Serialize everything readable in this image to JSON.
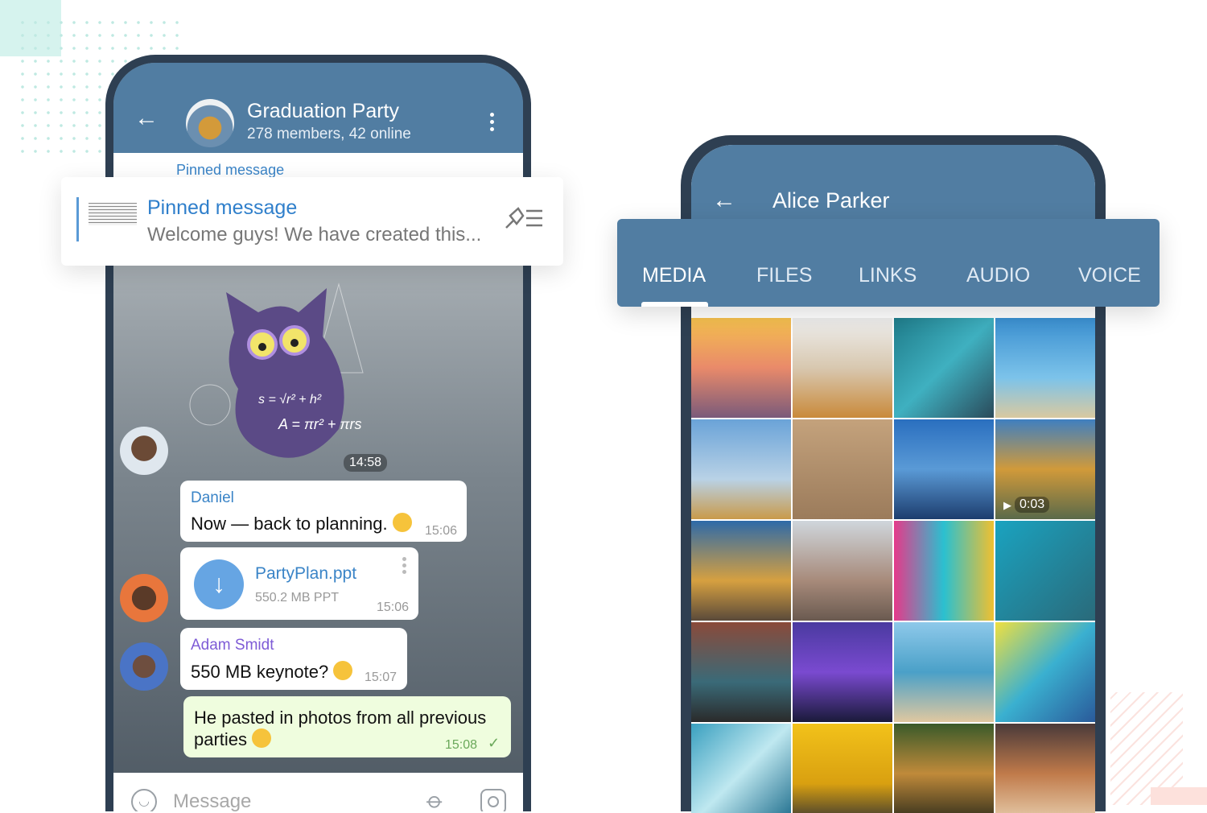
{
  "chat": {
    "title": "Graduation Party",
    "subtitle": "278 members, 42 online",
    "pinned": {
      "label": "Pinned message",
      "text": "Welcome guys! We have created this..."
    },
    "sticker": {
      "formula1": "s = √r² + h²",
      "formula2": "A = πr² + πrs",
      "time": "14:58"
    },
    "messages": [
      {
        "sender": "Daniel",
        "text": "Now — back to planning.",
        "emoji": "winking-face",
        "time": "15:06",
        "sender_color": "#3a84c7"
      },
      {
        "file_name": "PartyPlan.ppt",
        "file_meta": "550.2 MB PPT",
        "time": "15:06"
      },
      {
        "sender": "Adam Smidt",
        "text": "550 MB keynote?",
        "emoji": "thinking-face",
        "time": "15:07",
        "sender_color": "#7e5bd6"
      },
      {
        "text": "He pasted in photos from all previous parties",
        "emoji": "tears-of-joy",
        "time": "15:08",
        "status": "sent-check"
      }
    ],
    "input_placeholder": "Message"
  },
  "profile": {
    "title": "Alice Parker",
    "tabs": [
      {
        "label": "MEDIA",
        "active": true
      },
      {
        "label": "FILES",
        "active": false
      },
      {
        "label": "LINKS",
        "active": false
      },
      {
        "label": "AUDIO",
        "active": false
      },
      {
        "label": "VOICE",
        "active": false
      }
    ],
    "media": {
      "video_duration": "0:03"
    }
  },
  "colors": {
    "header": "#517da2",
    "accent": "#3a84c7",
    "outgoing_bubble": "#effdde"
  }
}
